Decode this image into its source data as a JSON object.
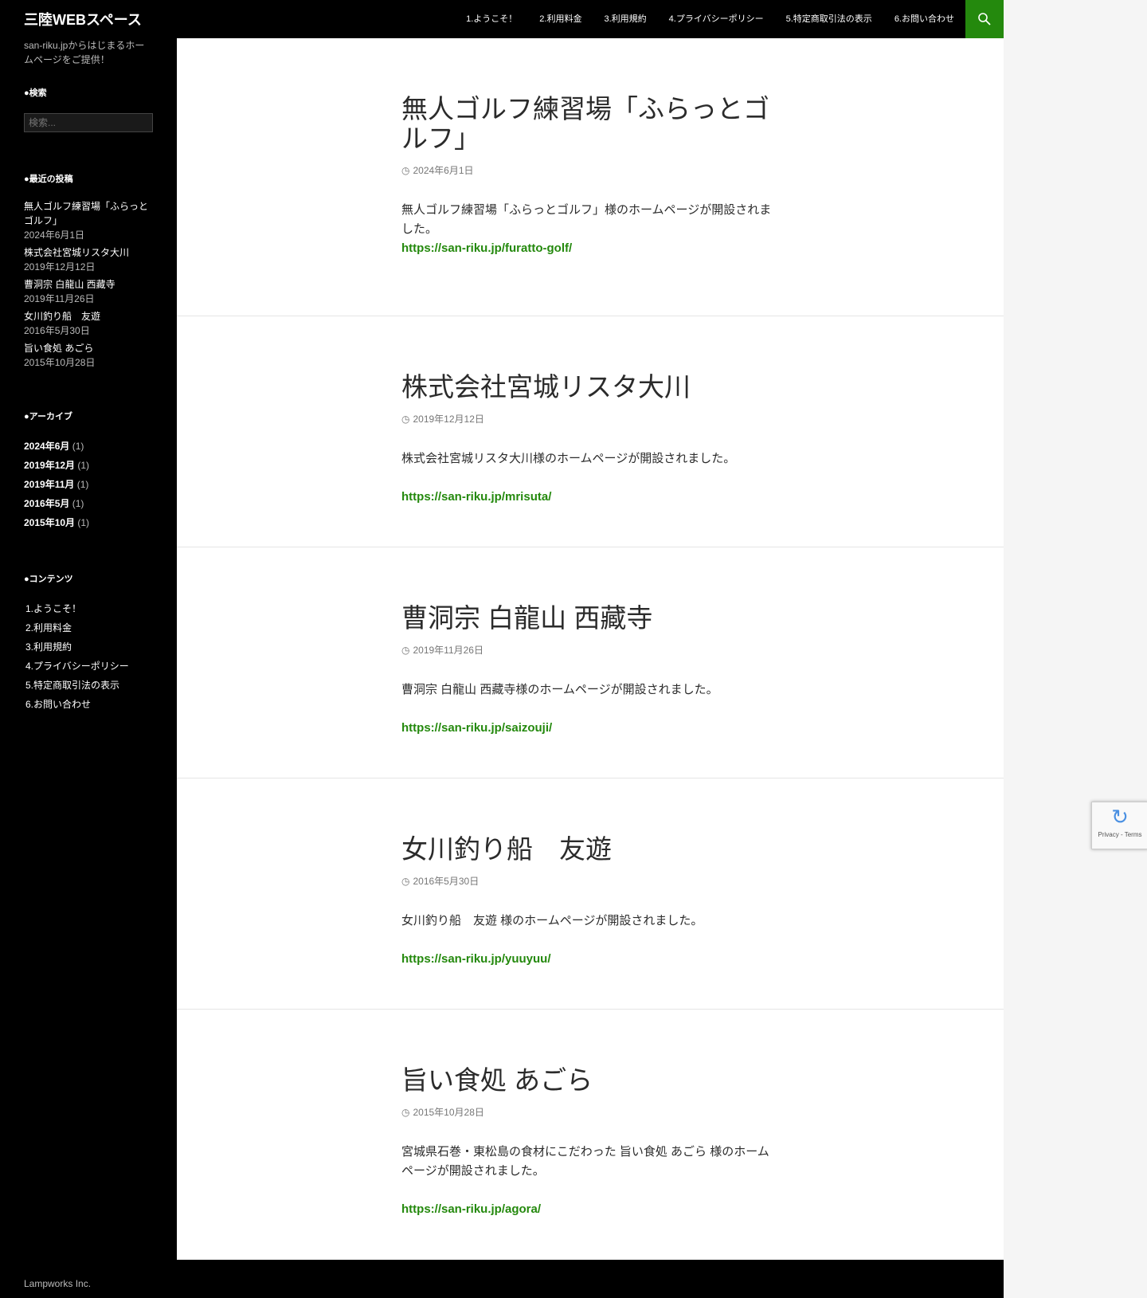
{
  "site": {
    "title": "三陸WEBスペース",
    "description": "san-riku.jpからはじまるホームページをご提供！"
  },
  "nav": [
    "1.ようこそ！",
    "2.利用料金",
    "3.利用規約",
    "4.プライバシーポリシー",
    "5.特定商取引法の表示",
    "6.お問い合わせ"
  ],
  "sidebar": {
    "search_title": "●検索",
    "search_placeholder": "検索...",
    "recent_title": "●最近の投稿",
    "recent": [
      {
        "t": "無人ゴルフ練習場「ふらっとゴルフ」",
        "d": "2024年6月1日"
      },
      {
        "t": "株式会社宮城リスタ大川",
        "d": "2019年12月12日"
      },
      {
        "t": "曹洞宗 白龍山 西藏寺",
        "d": "2019年11月26日"
      },
      {
        "t": "女川釣り船　友遊",
        "d": "2016年5月30日"
      },
      {
        "t": "旨い食処 あごら",
        "d": "2015年10月28日"
      }
    ],
    "archive_title": "●アーカイブ",
    "archives": [
      {
        "m": "2024年6月",
        "c": "(1)"
      },
      {
        "m": "2019年12月",
        "c": "(1)"
      },
      {
        "m": "2019年11月",
        "c": "(1)"
      },
      {
        "m": "2016年5月",
        "c": "(1)"
      },
      {
        "m": "2015年10月",
        "c": "(1)"
      }
    ],
    "contents_title": "●コンテンツ",
    "contents": [
      "1.ようこそ！",
      "2.利用料金",
      "3.利用規約",
      "4.プライバシーポリシー",
      "5.特定商取引法の表示",
      "6.お問い合わせ"
    ]
  },
  "posts": [
    {
      "title": "無人ゴルフ練習場「ふらっとゴルフ」",
      "date": "2024年6月1日",
      "text": "無人ゴルフ練習場「ふらっとゴルフ」様のホームページが開設されました。",
      "link": "https://san-riku.jp/furatto-golf/"
    },
    {
      "title": "株式会社宮城リスタ大川",
      "date": "2019年12月12日",
      "text": "株式会社宮城リスタ大川様のホームページが開設されました。",
      "link": "https://san-riku.jp/mrisuta/"
    },
    {
      "title": "曹洞宗 白龍山 西藏寺",
      "date": "2019年11月26日",
      "text": "曹洞宗 白龍山 西藏寺様のホームページが開設されました。",
      "link": "https://san-riku.jp/saizouji/"
    },
    {
      "title": "女川釣り船　友遊",
      "date": "2016年5月30日",
      "text": "女川釣り船　友遊 様のホームページが開設されました。",
      "link": "https://san-riku.jp/yuuyuu/"
    },
    {
      "title": "旨い食処 あごら",
      "date": "2015年10月28日",
      "text": "宮城県石巻・東松島の食材にこだわった 旨い食処 あごら 様のホームページが開設されました。",
      "link": "https://san-riku.jp/agora/"
    }
  ],
  "footer": {
    "credit": "Lampworks Inc."
  },
  "recaptcha": {
    "label": "Privacy - Terms"
  },
  "colors": {
    "accent": "#24890d"
  }
}
